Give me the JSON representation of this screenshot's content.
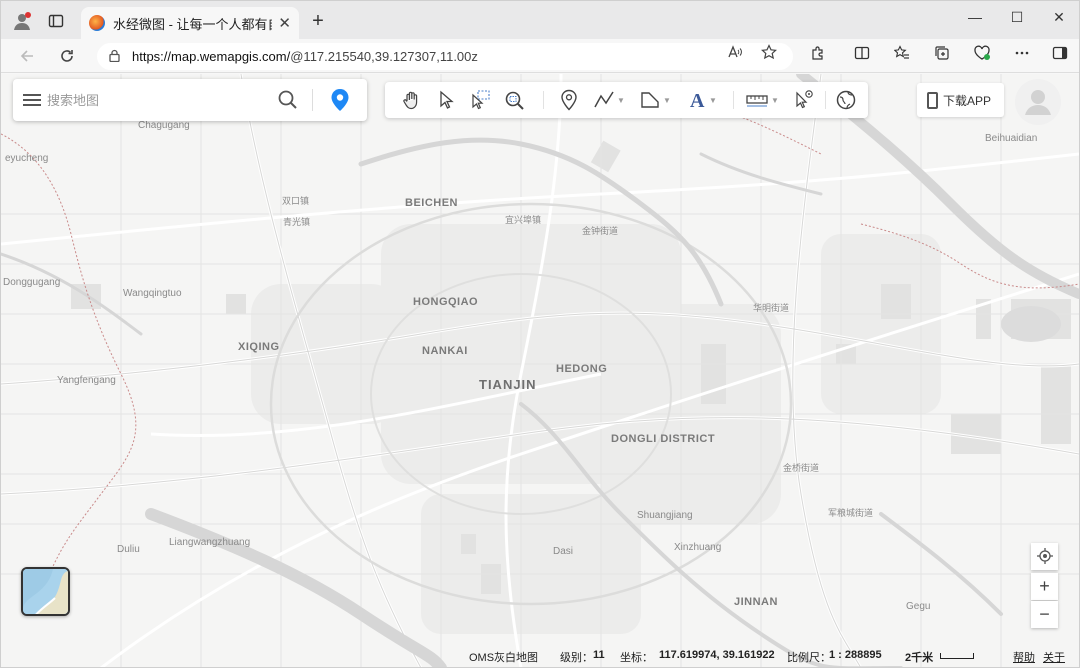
{
  "browser": {
    "tab_title": "水经微图 - 让每一个人都有自己的",
    "tab_close": "✕",
    "new_tab": "+",
    "url_host": "https://map.wemapgis.com/",
    "url_path": "@117.215540,39.127307,11.00z",
    "window_controls": {
      "minimize": "—",
      "maximize": "☐",
      "close": "✕"
    }
  },
  "search": {
    "placeholder": "搜索地图"
  },
  "toolbar": {
    "tools": [
      "pan-hand-icon",
      "select-arrow-icon",
      "box-select-icon",
      "zoom-region-icon",
      "marker-icon",
      "polyline-icon",
      "polygon-icon",
      "text-icon",
      "measure-ruler-icon",
      "query-pointer-icon",
      "globe-icon"
    ]
  },
  "download_app": {
    "label": "下载APP"
  },
  "map": {
    "labels": {
      "chagugang": "Chagugang",
      "eyucheng": "eyucheng",
      "beihuaidian": "Beihuaidian",
      "shuangkou": "双口镇",
      "qingguang": "青光镇",
      "beichen": "BEICHEN",
      "yixingbu": "宜兴埠镇",
      "jinzhong": "金钟街道",
      "donggugang": "Donggugang",
      "wangqingtuo": "Wangqingtuo",
      "hongqiao": "HONGQIAO",
      "huaming": "华明街道",
      "xiqing": "XIQING",
      "nankai": "NANKAI",
      "hedong": "HEDONG",
      "yangfengang": "Yangfengang",
      "tianjin": "TIANJIN",
      "dongli": "DONGLI DISTRICT",
      "jinqiao": "金桥街道",
      "shuangjiang": "Shuangjiang",
      "junliang": "军粮城街道",
      "duliu": "Duliu",
      "liangwangzhuang": "Liangwangzhuang",
      "dasi": "Dasi",
      "xinzhuang": "Xinzhuang",
      "jinnan": "JINNAN",
      "gegu": "Gegu"
    }
  },
  "controls": {
    "locate": "locate-icon",
    "zoom_in": "+",
    "zoom_out": "−"
  },
  "status": {
    "basemap": "OMS灰白地图",
    "level_label": "级别：",
    "level_value": "11",
    "coord_label": "坐标：",
    "coord_value": "117.619974, 39.161922",
    "scale_label": "比例尺：",
    "scale_value": "1 : 288895",
    "scalebar_label": "2千米",
    "help": "帮助",
    "about": "关于"
  }
}
